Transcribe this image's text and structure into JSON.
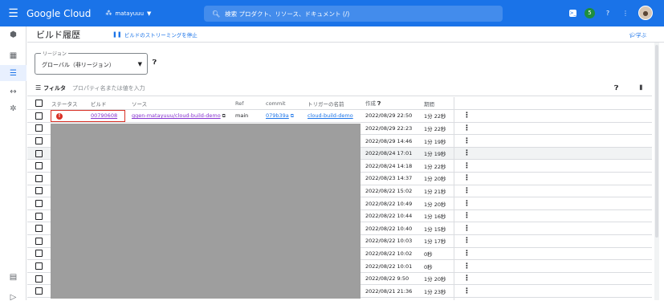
{
  "topbar": {
    "logo": "Google Cloud",
    "project": "matayuuu",
    "search_placeholder": "検索  プロダクト、リソース、ドキュメント (/)",
    "notification_badge": "5"
  },
  "header": {
    "title": "ビルド履歴",
    "stop_streaming": "ビルドのストリーミングを停止",
    "learn": "学ぶ"
  },
  "region": {
    "label": "リージョン",
    "value": "グローバル（非リージョン）"
  },
  "filter": {
    "label": "フィルタ",
    "placeholder": "プロパティ名または値を入力"
  },
  "table": {
    "headers": {
      "status": "ステータス",
      "build": "ビルド",
      "source": "ソース",
      "ref": "Ref",
      "commit": "commit",
      "trigger": "トリガーの名前",
      "created": "作成",
      "duration": "期間"
    },
    "first_row": {
      "build": "00790608",
      "source": "ggen-matayuuu/cloud-build-demo",
      "ref": "main",
      "commit": "079b39a",
      "trigger": "cloud-build-demo"
    },
    "rows": [
      {
        "created": "2022/08/29 22:50",
        "duration": "1分 22秒"
      },
      {
        "created": "2022/08/29 22:23",
        "duration": "1分 22秒"
      },
      {
        "created": "2022/08/29 14:46",
        "duration": "1分 19秒"
      },
      {
        "created": "2022/08/24 17:01",
        "duration": "1分 19秒"
      },
      {
        "created": "2022/08/24 14:18",
        "duration": "1分 22秒"
      },
      {
        "created": "2022/08/23 14:37",
        "duration": "1分 20秒"
      },
      {
        "created": "2022/08/22 15:02",
        "duration": "1分 21秒"
      },
      {
        "created": "2022/08/22 10:49",
        "duration": "1分 20秒"
      },
      {
        "created": "2022/08/22 10:44",
        "duration": "1分 16秒"
      },
      {
        "created": "2022/08/22 10:40",
        "duration": "1分 15秒"
      },
      {
        "created": "2022/08/22 10:03",
        "duration": "1分 17秒"
      },
      {
        "created": "2022/08/22 10:02",
        "duration": "0秒"
      },
      {
        "created": "2022/08/22 10:01",
        "duration": "0秒"
      },
      {
        "created": "2022/08/22 9:50",
        "duration": "1分 20秒"
      },
      {
        "created": "2022/08/21 21:36",
        "duration": "1分 23秒"
      }
    ]
  },
  "colors": {
    "accent": "#1a73e8",
    "error": "#d93025",
    "mask": "#9e9e9e"
  }
}
